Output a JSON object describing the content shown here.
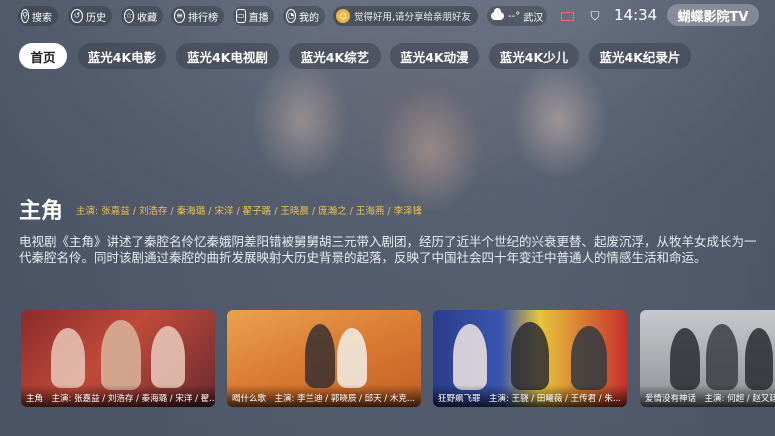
{
  "topbar": {
    "buttons": [
      {
        "label": "搜索",
        "icon": "search-icon"
      },
      {
        "label": "历史",
        "icon": "history-icon"
      },
      {
        "label": "收藏",
        "icon": "star-icon"
      },
      {
        "label": "排行榜",
        "icon": "ranking-icon"
      },
      {
        "label": "直播",
        "icon": "tv-icon"
      },
      {
        "label": "我的",
        "icon": "user-icon"
      }
    ],
    "notice": "觉得好用,请分享给亲朋好友",
    "weather": {
      "temp": "--°",
      "city": "武汉"
    },
    "time": "14:34",
    "brand": "蝴蝶影院TV"
  },
  "tabs": [
    "首页",
    "蓝光4K电影",
    "蓝光4K电视剧",
    "蓝光4K综艺",
    "蓝光4K动漫",
    "蓝光4K少儿",
    "蓝光4K纪录片"
  ],
  "featured": {
    "title": "主角",
    "cast": "主演: 张嘉益 / 刘浩存 / 秦海璐 / 宋洋 / 翟子路 / 王晓晨 / 庞瀚之 / 王海燕 / 李泽锋",
    "description": "电视剧《主角》讲述了秦腔名伶忆秦娥阴差阳错被舅舅胡三元带入剧团，经历了近半个世纪的兴衰更替、起废沉浮，从牧羊女成长为一代秦腔名伶。同时该剧通过秦腔的曲折发展映射大历史背景的起落，反映了中国社会四十年变迁中普通人的情感生活和命运。"
  },
  "cards": [
    {
      "caption": "主角　主演: 张嘉益 / 刘浩存 / 秦海璐 / 宋洋 / 翟..."
    },
    {
      "caption": "喝什么歌　主演: 李兰迪 / 郭晓辰 / 邱天 / 木克..."
    },
    {
      "caption": "狂野飙飞罪　主演: 王骁 / 田曦薇 / 王传君 / 朱..."
    },
    {
      "caption": "爱情没有神话　主演: 何超 / 赵又廷..."
    }
  ],
  "colors": {
    "accent": "#f0c34a",
    "active_tab_bg": "#ffffff",
    "mail_icon": "#ff6b6b"
  }
}
